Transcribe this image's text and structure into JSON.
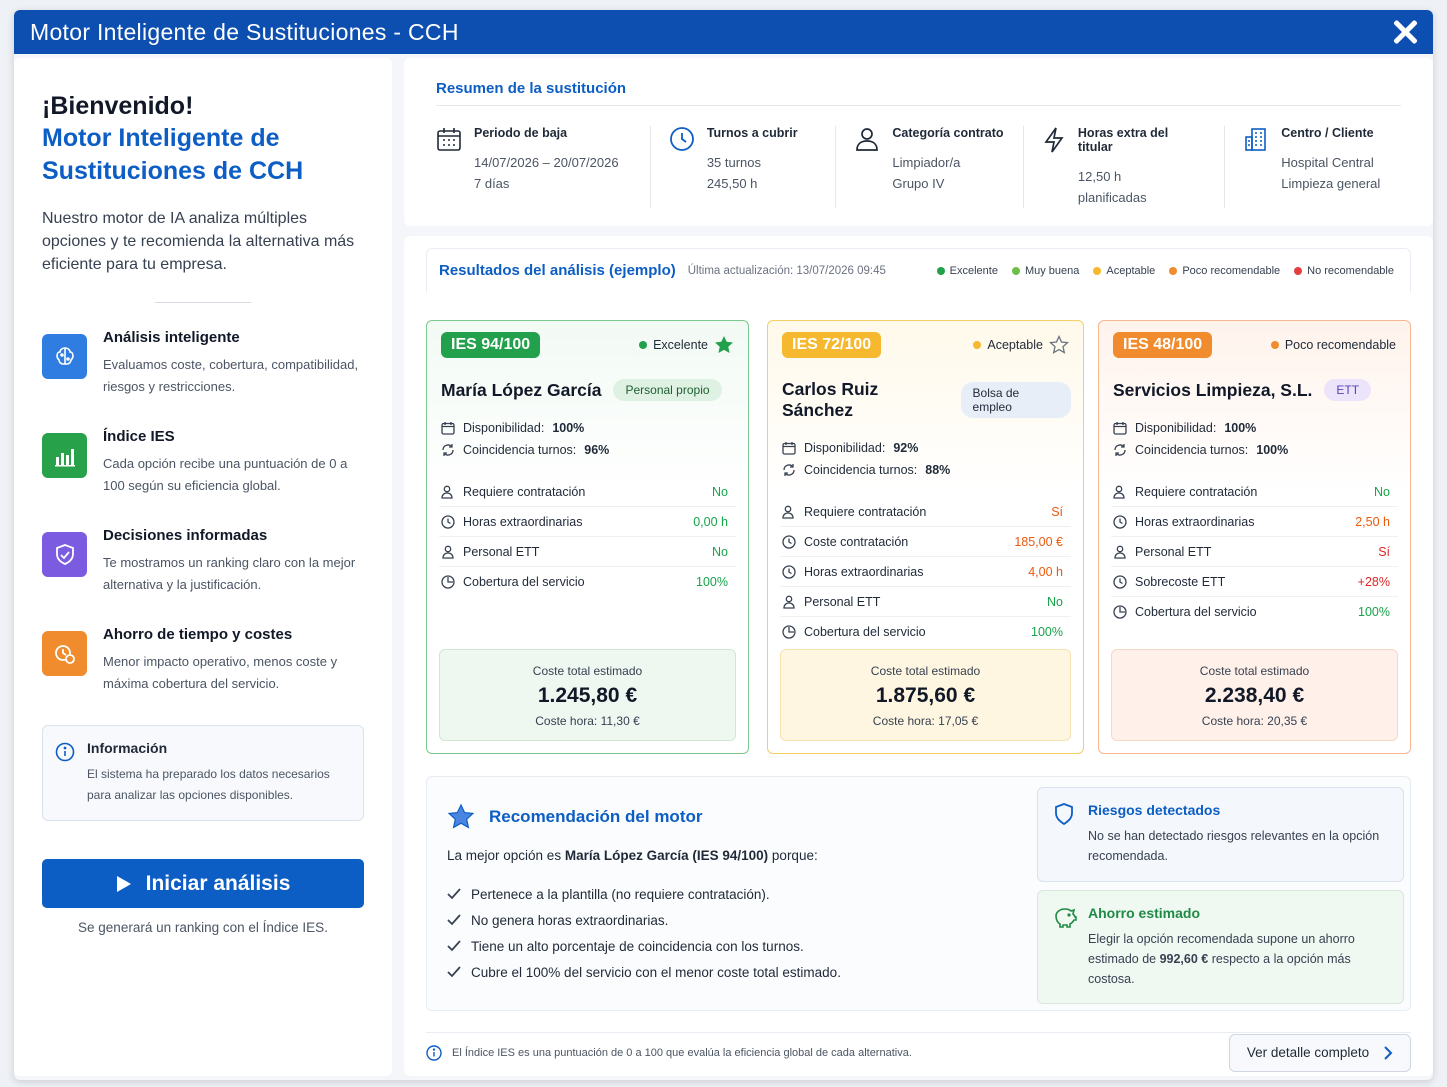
{
  "window": {
    "title": "Motor Inteligente de Sustituciones - CCH"
  },
  "left": {
    "welcome": "¡Bienvenido!",
    "brand_line1": "Motor Inteligente de",
    "brand_line2": "Sustituciones de CCH",
    "intro": "Nuestro motor de IA analiza múltiples opciones y te recomienda la alternativa más eficiente para tu empresa.",
    "features": [
      {
        "title": "Análisis inteligente",
        "desc": "Evaluamos coste, cobertura, compatibilidad, riesgos y restricciones.",
        "icon": "brain-icon",
        "color": "#2f7de1"
      },
      {
        "title": "Índice IES",
        "desc": "Cada opción recibe una puntuación de 0 a 100 según su eficiencia global.",
        "icon": "bar-chart-icon",
        "color": "#27a24a"
      },
      {
        "title": "Decisiones informadas",
        "desc": "Te mostramos un ranking claro con la mejor alternativa y la justificación.",
        "icon": "shield-check-icon",
        "color": "#7b5ce0"
      },
      {
        "title": "Ahorro de tiempo y costes",
        "desc": "Menor impacto operativo, menos coste y máxima cobertura del servicio.",
        "icon": "clock-coin-icon",
        "color": "#f08c2e"
      }
    ],
    "info": {
      "title": "Información",
      "desc": "El sistema ha preparado los datos necesarios para analizar las opciones disponibles."
    },
    "start_button": "Iniciar análisis",
    "start_note": "Se generará un ranking con el Índice IES."
  },
  "summary": {
    "title": "Resumen de la sustitución",
    "cols": [
      {
        "label": "Periodo de baja",
        "v1": "14/07/2026 – 20/07/2026",
        "v2": "7 días",
        "icon": "calendar-icon"
      },
      {
        "label": "Turnos a cubrir",
        "v1": "35 turnos",
        "v2": "245,50 h",
        "icon": "clock-icon"
      },
      {
        "label": "Categoría contrato",
        "v1": "Limpiador/a",
        "v2": "Grupo IV",
        "icon": "user-icon"
      },
      {
        "label": "Horas extra del titular",
        "v1": "12,50 h",
        "v2": "planificadas",
        "icon": "lightning-icon"
      },
      {
        "label": "Centro / Cliente",
        "v1": "Hospital Central",
        "v2": "Limpieza general",
        "icon": "building-icon"
      }
    ]
  },
  "results": {
    "title": "Resultados del análisis (ejemplo)",
    "updated": "Última actualización: 13/07/2026 09:45",
    "legend": [
      {
        "label": "Excelente",
        "color": "#22a04b"
      },
      {
        "label": "Muy buena",
        "color": "#6cc04a"
      },
      {
        "label": "Aceptable",
        "color": "#f5b82e"
      },
      {
        "label": "Poco recomendable",
        "color": "#f08c2e"
      },
      {
        "label": "No recomendable",
        "color": "#e53e3e"
      }
    ],
    "cards": [
      {
        "ies": "IES 94/100",
        "rating": "Excelente",
        "name": "María López García",
        "tag": "Personal propio",
        "availability_label": "Disponibilidad:",
        "availability": "100%",
        "match_label": "Coincidencia turnos:",
        "match": "96%",
        "rows": [
          {
            "label": "Requiere contratación",
            "value": "No",
            "icon": "user-check-icon",
            "tone": "g"
          },
          {
            "label": "Horas extraordinarias",
            "value": "0,00 h",
            "icon": "clock-icon",
            "tone": "g"
          },
          {
            "label": "Personal ETT",
            "value": "No",
            "icon": "user-icon",
            "tone": "g"
          },
          {
            "label": "Cobertura del servicio",
            "value": "100%",
            "icon": "coverage-icon",
            "tone": "g"
          }
        ],
        "cost_label": "Coste total estimado",
        "cost": "1.245,80 €",
        "hour_cost": "Coste hora: 11,30 €"
      },
      {
        "ies": "IES 72/100",
        "rating": "Aceptable",
        "name": "Carlos Ruiz Sánchez",
        "tag": "Bolsa de empleo",
        "availability_label": "Disponibilidad:",
        "availability": "92%",
        "match_label": "Coincidencia turnos:",
        "match": "88%",
        "rows": [
          {
            "label": "Requiere contratación",
            "value": "Sí",
            "icon": "user-check-icon",
            "tone": "o"
          },
          {
            "label": "Coste contratación",
            "value": "185,00 €",
            "icon": "clock-icon",
            "tone": "o"
          },
          {
            "label": "Horas extraordinarias",
            "value": "4,00 h",
            "icon": "clock-icon",
            "tone": "o"
          },
          {
            "label": "Personal ETT",
            "value": "No",
            "icon": "user-icon",
            "tone": "g"
          },
          {
            "label": "Cobertura del servicio",
            "value": "100%",
            "icon": "coverage-icon",
            "tone": "g"
          }
        ],
        "cost_label": "Coste total estimado",
        "cost": "1.875,60 €",
        "hour_cost": "Coste hora: 17,05 €"
      },
      {
        "ies": "IES 48/100",
        "rating": "Poco recomendable",
        "name": "Servicios Limpieza, S.L.",
        "tag": "ETT",
        "availability_label": "Disponibilidad:",
        "availability": "100%",
        "match_label": "Coincidencia turnos:",
        "match": "100%",
        "rows": [
          {
            "label": "Requiere contratación",
            "value": "No",
            "icon": "user-check-icon",
            "tone": "g"
          },
          {
            "label": "Horas extraordinarias",
            "value": "2,50 h",
            "icon": "clock-icon",
            "tone": "o"
          },
          {
            "label": "Personal ETT",
            "value": "Sí",
            "icon": "user-icon",
            "tone": "r"
          },
          {
            "label": "Sobrecoste ETT",
            "value": "+28%",
            "icon": "clock-icon",
            "tone": "r"
          },
          {
            "label": "Cobertura del servicio",
            "value": "100%",
            "icon": "coverage-icon",
            "tone": "g"
          }
        ],
        "cost_label": "Coste total estimado",
        "cost": "2.238,40 €",
        "hour_cost": "Coste hora: 20,35 €"
      }
    ]
  },
  "recommendation": {
    "title": "Recomendación del motor",
    "intro_a": "La mejor opción es ",
    "intro_b": "María López García (IES 94/100)",
    "intro_c": " porque:",
    "reasons": [
      "Pertenece a la plantilla (no requiere contratación).",
      "No genera horas extraordinarias.",
      "Tiene un alto porcentaje de coincidencia con los turnos.",
      "Cubre el 100% del servicio con el menor coste total estimado."
    ],
    "risks": {
      "title": "Riesgos detectados",
      "desc": "No se han detectado riesgos relevantes en la opción recomendada."
    },
    "savings": {
      "title": "Ahorro estimado",
      "desc_a": "Elegir la opción recomendada supone un ahorro estimado de ",
      "desc_b": "992,60 €",
      "desc_c": " respecto a la opción más costosa."
    }
  },
  "footer": {
    "note": "El Índice IES es una puntuación de 0 a 100 que evalúa la eficiencia global de cada alternativa.",
    "detail_button": "Ver detalle completo"
  }
}
